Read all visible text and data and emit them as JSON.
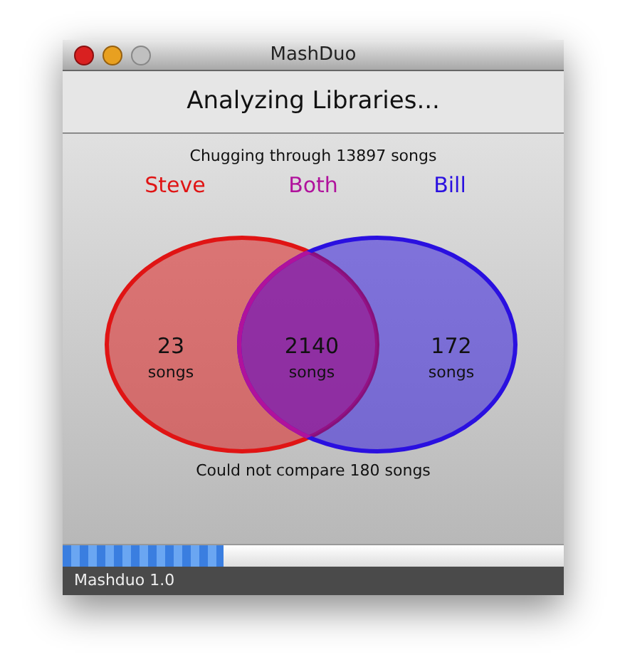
{
  "window": {
    "title": "MashDuo"
  },
  "heading": "Analyzing Libraries...",
  "progress_text": "Chugging through 13897 songs",
  "venn": {
    "sets": [
      {
        "label": "Steve",
        "color": "#e01414",
        "count": "23",
        "unit": "songs"
      },
      {
        "label": "Bill",
        "color": "#2a10e0",
        "count": "172",
        "unit": "songs"
      }
    ],
    "overlap": {
      "label": "Both",
      "color": "#b0129c",
      "count": "2140",
      "unit": "songs"
    }
  },
  "footer_text": "Could not compare 180 songs",
  "progress": {
    "level": 0.32
  },
  "status_bar": "Mashduo 1.0"
}
